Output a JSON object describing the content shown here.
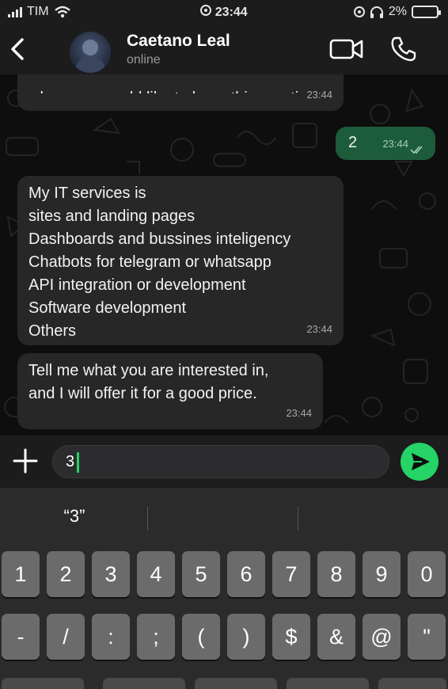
{
  "status_bar": {
    "carrier": "TIM",
    "time": "23:44",
    "battery": "2%"
  },
  "header": {
    "contact_name": "Caetano Leal",
    "contact_status": "online"
  },
  "messages": [
    {
      "direction": "in",
      "text": "when you would like to have this meeting.",
      "time": "23:44"
    },
    {
      "direction": "out",
      "text": "2",
      "time": "23:44",
      "status": "read"
    },
    {
      "direction": "in",
      "text": "My IT services is\nsites and landing pages\nDashboards and bussines inteligency\nChatbots for telegram or whatsapp\nAPI integration or development\nSoftware development\nOthers",
      "time": "23:44"
    },
    {
      "direction": "in",
      "text": "Tell me what you are interested in,\nand I will offer it for a good price.",
      "time": "23:44"
    }
  ],
  "composer": {
    "value": "3"
  },
  "keyboard": {
    "suggestions": [
      "“3”",
      "",
      ""
    ],
    "row1": [
      "1",
      "2",
      "3",
      "4",
      "5",
      "6",
      "7",
      "8",
      "9",
      "0"
    ],
    "row2": [
      "-",
      "/",
      ":",
      ";",
      "(",
      ")",
      "$",
      "&",
      "@",
      "\""
    ]
  },
  "icons": {
    "back": "chevron-left-icon",
    "video": "video-camera-icon",
    "call": "phone-icon",
    "attach": "plus-icon",
    "sticker": "sticker-icon",
    "send": "send-icon"
  },
  "colors": {
    "accent": "#25d366",
    "outgoing_bubble": "#1d5c3b",
    "incoming_bubble": "#272727"
  }
}
